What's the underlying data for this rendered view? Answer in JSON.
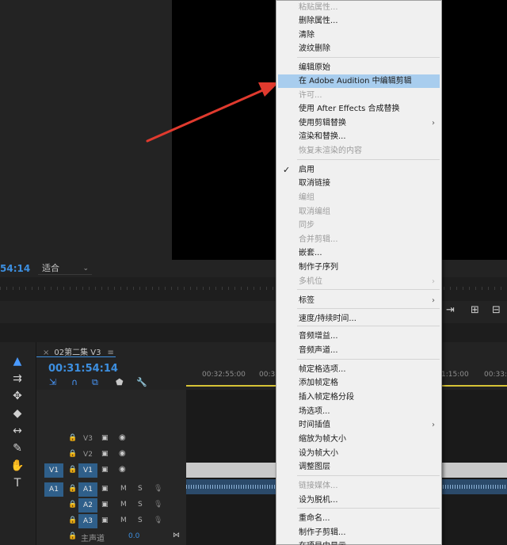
{
  "monitor": {
    "timecode": "54:14",
    "fit_label": "适合"
  },
  "tools": {
    "selection": "▲",
    "track_select": "⇉",
    "ripple": "✥",
    "razor": "◆",
    "slip": "↔",
    "pen": "✎",
    "hand": "✋",
    "type": "T"
  },
  "timeline": {
    "tab_label": "02第二集 V3",
    "timecode": "00:31:54:14",
    "ruler_ticks": [
      "00:32:55:00",
      "00:33",
      "1:15:00",
      "00:33:2"
    ],
    "master_label": "主声道",
    "master_value": "0.0",
    "tracks": [
      {
        "name": "V3",
        "src": "",
        "kind": "video"
      },
      {
        "name": "V2",
        "src": "",
        "kind": "video"
      },
      {
        "name": "V1",
        "src": "V1",
        "kind": "video"
      },
      {
        "name": "A1",
        "src": "A1",
        "kind": "audio"
      },
      {
        "name": "A2",
        "src": "",
        "kind": "audio"
      },
      {
        "name": "A3",
        "src": "",
        "kind": "audio"
      }
    ],
    "mute": "M",
    "solo": "S"
  },
  "menu": {
    "items": [
      {
        "label": "粘贴属性...",
        "disabled": true
      },
      {
        "label": "删除属性...",
        "disabled": false
      },
      {
        "label": "清除",
        "disabled": false
      },
      {
        "label": "波纹删除",
        "disabled": false
      },
      {
        "label": "编辑原始",
        "disabled": false
      },
      {
        "label": "在 Adobe Audition 中编辑剪辑",
        "disabled": false
      },
      {
        "label": "许可...",
        "disabled": true
      },
      {
        "label": "使用 After Effects 合成替换",
        "disabled": false
      },
      {
        "label": "使用剪辑替换",
        "disabled": false
      },
      {
        "label": "渲染和替换...",
        "disabled": false
      },
      {
        "label": "恢复未渲染的内容",
        "disabled": true
      },
      {
        "label": "启用",
        "disabled": false
      },
      {
        "label": "取消链接",
        "disabled": false
      },
      {
        "label": "编组",
        "disabled": true
      },
      {
        "label": "取消编组",
        "disabled": true
      },
      {
        "label": "同步",
        "disabled": true
      },
      {
        "label": "合并剪辑...",
        "disabled": true
      },
      {
        "label": "嵌套...",
        "disabled": false
      },
      {
        "label": "制作子序列",
        "disabled": false
      },
      {
        "label": "多机位",
        "disabled": true
      },
      {
        "label": "标签",
        "disabled": false
      },
      {
        "label": "速度/持续时间...",
        "disabled": false
      },
      {
        "label": "音频增益...",
        "disabled": false
      },
      {
        "label": "音频声道...",
        "disabled": false
      },
      {
        "label": "帧定格选项...",
        "disabled": false
      },
      {
        "label": "添加帧定格",
        "disabled": false
      },
      {
        "label": "插入帧定格分段",
        "disabled": false
      },
      {
        "label": "场选项...",
        "disabled": false
      },
      {
        "label": "时间插值",
        "disabled": false
      },
      {
        "label": "缩放为帧大小",
        "disabled": false
      },
      {
        "label": "设为帧大小",
        "disabled": false
      },
      {
        "label": "调整图层",
        "disabled": false
      },
      {
        "label": "链接媒体...",
        "disabled": true
      },
      {
        "label": "设为脱机...",
        "disabled": false
      },
      {
        "label": "重命名...",
        "disabled": false
      },
      {
        "label": "制作子剪辑...",
        "disabled": false
      },
      {
        "label": "在项目中显示",
        "disabled": false
      }
    ],
    "submenu_arrow": "›",
    "checkmark": "✓"
  },
  "colors": {
    "accent_blue": "#3d8fe0",
    "menu_highlight": "#a8cdee",
    "arrow_red": "#e03a2e"
  }
}
